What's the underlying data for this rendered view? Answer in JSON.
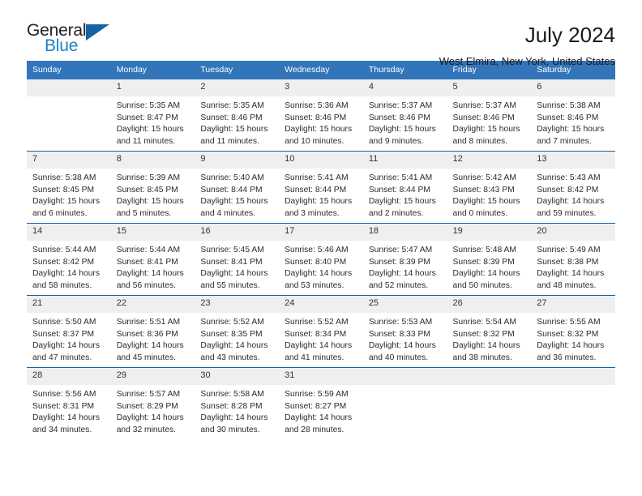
{
  "brand": {
    "name_primary": "General",
    "name_secondary": "Blue",
    "triangle_icon": "triangle-logo-icon",
    "accent_color": "#1464a5"
  },
  "header": {
    "title": "July 2024",
    "subtitle": "West Elmira, New York, United States"
  },
  "theme": {
    "header_row_bg": "#3275ba",
    "daynum_bg": "#efefef",
    "cell_border": "#1464a5",
    "text": "#2b2b2b"
  },
  "calendar": {
    "weekday_headers": [
      "Sunday",
      "Monday",
      "Tuesday",
      "Wednesday",
      "Thursday",
      "Friday",
      "Saturday"
    ],
    "weeks": [
      [
        {
          "day": "",
          "lines": []
        },
        {
          "day": "1",
          "lines": [
            "Sunrise: 5:35 AM",
            "Sunset: 8:47 PM",
            "Daylight: 15 hours",
            "and 11 minutes."
          ]
        },
        {
          "day": "2",
          "lines": [
            "Sunrise: 5:35 AM",
            "Sunset: 8:46 PM",
            "Daylight: 15 hours",
            "and 11 minutes."
          ]
        },
        {
          "day": "3",
          "lines": [
            "Sunrise: 5:36 AM",
            "Sunset: 8:46 PM",
            "Daylight: 15 hours",
            "and 10 minutes."
          ]
        },
        {
          "day": "4",
          "lines": [
            "Sunrise: 5:37 AM",
            "Sunset: 8:46 PM",
            "Daylight: 15 hours",
            "and 9 minutes."
          ]
        },
        {
          "day": "5",
          "lines": [
            "Sunrise: 5:37 AM",
            "Sunset: 8:46 PM",
            "Daylight: 15 hours",
            "and 8 minutes."
          ]
        },
        {
          "day": "6",
          "lines": [
            "Sunrise: 5:38 AM",
            "Sunset: 8:46 PM",
            "Daylight: 15 hours",
            "and 7 minutes."
          ]
        }
      ],
      [
        {
          "day": "7",
          "lines": [
            "Sunrise: 5:38 AM",
            "Sunset: 8:45 PM",
            "Daylight: 15 hours",
            "and 6 minutes."
          ]
        },
        {
          "day": "8",
          "lines": [
            "Sunrise: 5:39 AM",
            "Sunset: 8:45 PM",
            "Daylight: 15 hours",
            "and 5 minutes."
          ]
        },
        {
          "day": "9",
          "lines": [
            "Sunrise: 5:40 AM",
            "Sunset: 8:44 PM",
            "Daylight: 15 hours",
            "and 4 minutes."
          ]
        },
        {
          "day": "10",
          "lines": [
            "Sunrise: 5:41 AM",
            "Sunset: 8:44 PM",
            "Daylight: 15 hours",
            "and 3 minutes."
          ]
        },
        {
          "day": "11",
          "lines": [
            "Sunrise: 5:41 AM",
            "Sunset: 8:44 PM",
            "Daylight: 15 hours",
            "and 2 minutes."
          ]
        },
        {
          "day": "12",
          "lines": [
            "Sunrise: 5:42 AM",
            "Sunset: 8:43 PM",
            "Daylight: 15 hours",
            "and 0 minutes."
          ]
        },
        {
          "day": "13",
          "lines": [
            "Sunrise: 5:43 AM",
            "Sunset: 8:42 PM",
            "Daylight: 14 hours",
            "and 59 minutes."
          ]
        }
      ],
      [
        {
          "day": "14",
          "lines": [
            "Sunrise: 5:44 AM",
            "Sunset: 8:42 PM",
            "Daylight: 14 hours",
            "and 58 minutes."
          ]
        },
        {
          "day": "15",
          "lines": [
            "Sunrise: 5:44 AM",
            "Sunset: 8:41 PM",
            "Daylight: 14 hours",
            "and 56 minutes."
          ]
        },
        {
          "day": "16",
          "lines": [
            "Sunrise: 5:45 AM",
            "Sunset: 8:41 PM",
            "Daylight: 14 hours",
            "and 55 minutes."
          ]
        },
        {
          "day": "17",
          "lines": [
            "Sunrise: 5:46 AM",
            "Sunset: 8:40 PM",
            "Daylight: 14 hours",
            "and 53 minutes."
          ]
        },
        {
          "day": "18",
          "lines": [
            "Sunrise: 5:47 AM",
            "Sunset: 8:39 PM",
            "Daylight: 14 hours",
            "and 52 minutes."
          ]
        },
        {
          "day": "19",
          "lines": [
            "Sunrise: 5:48 AM",
            "Sunset: 8:39 PM",
            "Daylight: 14 hours",
            "and 50 minutes."
          ]
        },
        {
          "day": "20",
          "lines": [
            "Sunrise: 5:49 AM",
            "Sunset: 8:38 PM",
            "Daylight: 14 hours",
            "and 48 minutes."
          ]
        }
      ],
      [
        {
          "day": "21",
          "lines": [
            "Sunrise: 5:50 AM",
            "Sunset: 8:37 PM",
            "Daylight: 14 hours",
            "and 47 minutes."
          ]
        },
        {
          "day": "22",
          "lines": [
            "Sunrise: 5:51 AM",
            "Sunset: 8:36 PM",
            "Daylight: 14 hours",
            "and 45 minutes."
          ]
        },
        {
          "day": "23",
          "lines": [
            "Sunrise: 5:52 AM",
            "Sunset: 8:35 PM",
            "Daylight: 14 hours",
            "and 43 minutes."
          ]
        },
        {
          "day": "24",
          "lines": [
            "Sunrise: 5:52 AM",
            "Sunset: 8:34 PM",
            "Daylight: 14 hours",
            "and 41 minutes."
          ]
        },
        {
          "day": "25",
          "lines": [
            "Sunrise: 5:53 AM",
            "Sunset: 8:33 PM",
            "Daylight: 14 hours",
            "and 40 minutes."
          ]
        },
        {
          "day": "26",
          "lines": [
            "Sunrise: 5:54 AM",
            "Sunset: 8:32 PM",
            "Daylight: 14 hours",
            "and 38 minutes."
          ]
        },
        {
          "day": "27",
          "lines": [
            "Sunrise: 5:55 AM",
            "Sunset: 8:32 PM",
            "Daylight: 14 hours",
            "and 36 minutes."
          ]
        }
      ],
      [
        {
          "day": "28",
          "lines": [
            "Sunrise: 5:56 AM",
            "Sunset: 8:31 PM",
            "Daylight: 14 hours",
            "and 34 minutes."
          ]
        },
        {
          "day": "29",
          "lines": [
            "Sunrise: 5:57 AM",
            "Sunset: 8:29 PM",
            "Daylight: 14 hours",
            "and 32 minutes."
          ]
        },
        {
          "day": "30",
          "lines": [
            "Sunrise: 5:58 AM",
            "Sunset: 8:28 PM",
            "Daylight: 14 hours",
            "and 30 minutes."
          ]
        },
        {
          "day": "31",
          "lines": [
            "Sunrise: 5:59 AM",
            "Sunset: 8:27 PM",
            "Daylight: 14 hours",
            "and 28 minutes."
          ]
        },
        {
          "day": "",
          "lines": []
        },
        {
          "day": "",
          "lines": []
        },
        {
          "day": "",
          "lines": []
        }
      ]
    ]
  }
}
